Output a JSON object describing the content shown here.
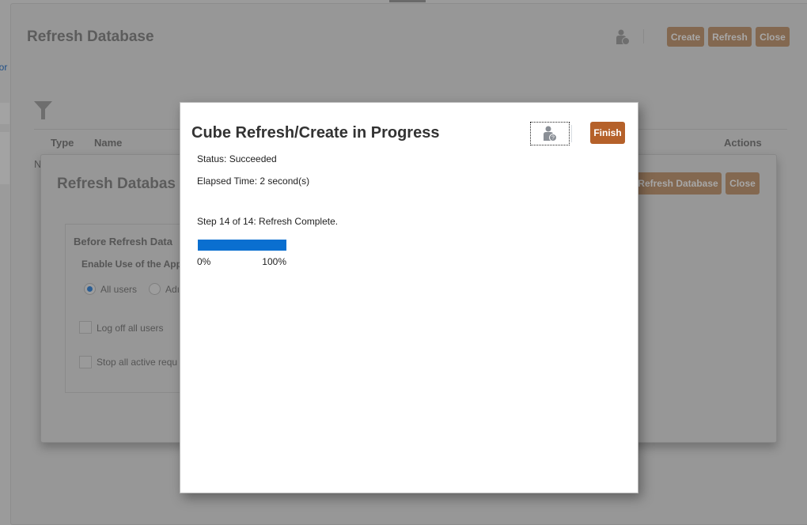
{
  "background_page": {
    "title": "Refresh Database",
    "left_link_fragment": "oor",
    "buttons": {
      "create": "Create",
      "refresh": "Refresh",
      "close": "Close"
    },
    "table": {
      "columns": [
        "Type",
        "Name",
        "Actions"
      ],
      "row_fragment": "N"
    }
  },
  "background_dialog": {
    "title": "Refresh Databas",
    "buttons": {
      "refresh_database": "Refresh Database",
      "close": "Close"
    },
    "group_title": "Before Refresh Data",
    "enable_label": "Enable Use of the App",
    "radio_all": "All users",
    "radio_admin": "Adı",
    "checkbox_logoff": "Log off all users",
    "checkbox_stop": "Stop all active requ"
  },
  "modal": {
    "title": "Cube Refresh/Create in Progress",
    "finish": "Finish",
    "status": "Status: Succeeded",
    "elapsed": "Elapsed Time: 2 second(s)",
    "step": "Step 14 of 14: Refresh Complete.",
    "progress_percent": 100,
    "progress_min_label": "0%",
    "progress_max_label": "100%"
  },
  "colors": {
    "accent": "#b5612a",
    "progress": "#0a6fd0",
    "dimmed_button": "#836850"
  }
}
